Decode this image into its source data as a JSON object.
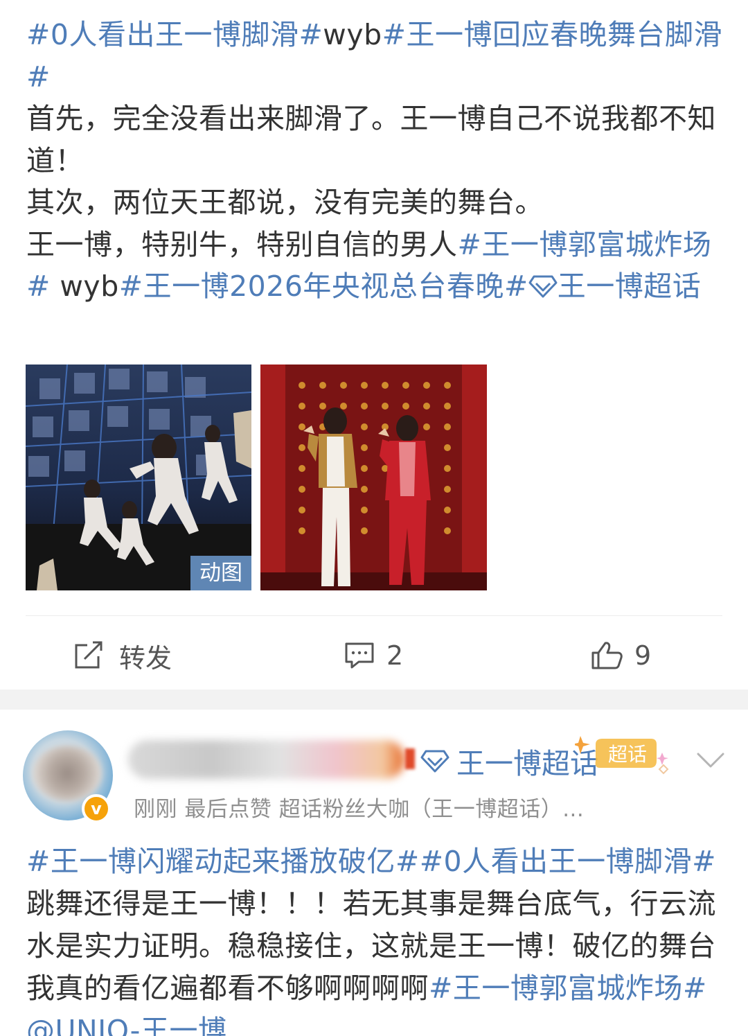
{
  "post1": {
    "segments": [
      {
        "text": "#0人看出王一博脚滑#",
        "type": "tag"
      },
      {
        "text": "wyb",
        "type": "text"
      },
      {
        "text": "#王一博回应春晚舞台脚滑#",
        "type": "tag"
      },
      {
        "text": "\n首先，完全没看出来脚滑了。王一博自己不说我都不知道！\n其次，两位天王都说，没有完美的舞台。\n王一博，特别牛，特别自信的男人",
        "type": "text"
      },
      {
        "text": "#王一博郭富城炸场#",
        "type": "tag"
      },
      {
        "text": " wyb",
        "type": "text"
      },
      {
        "text": "#王一博2026年央视总台春晚#",
        "type": "tag"
      },
      {
        "text": "",
        "type": "supertopic-icon"
      },
      {
        "text": "王一博超话",
        "type": "tag"
      }
    ],
    "images": [
      {
        "alt": "dance stage animated image",
        "badge": "动图"
      },
      {
        "alt": "two performers on red stage",
        "badge": ""
      }
    ],
    "actions": {
      "repost_label": "转发",
      "comment_count": "2",
      "like_count": "9"
    }
  },
  "post2": {
    "topic_link": "王一博超话",
    "topic_badge": "超话",
    "meta": "刚刚 最后点赞   超话粉丝大咖（王一博超话）...",
    "segments": [
      {
        "text": "#王一博闪耀动起来播放破亿##0人看出王一博脚滑#",
        "type": "tag"
      },
      {
        "text": "跳舞还得是王一博！！！若无其事是舞台底气，行云流水是实力证明。稳稳接住，这就是王一博！破亿的舞台我真的看亿遍都看不够啊啊啊啊",
        "type": "text"
      },
      {
        "text": "#王一博郭富城炸场#",
        "type": "tag"
      },
      {
        "text": " ",
        "type": "text"
      },
      {
        "text": "@UNIQ-王一博",
        "type": "tag"
      }
    ]
  },
  "colors": {
    "link": "#4f7db8",
    "text": "#333333",
    "meta": "#8f8f8f",
    "separator": "#f2f2f2",
    "badge_bg": "#5f86b4"
  }
}
